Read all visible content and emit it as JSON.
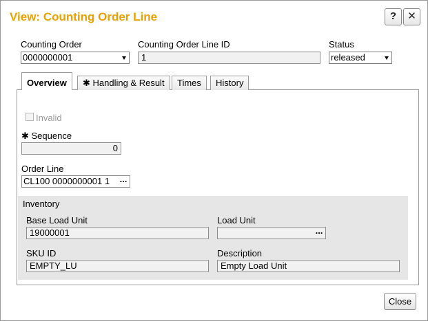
{
  "window": {
    "title": "View: Counting Order Line",
    "help_label": "?",
    "close_label": "✕"
  },
  "header": {
    "counting_order": {
      "label": "Counting Order",
      "value": "0000000001"
    },
    "line_id": {
      "label": "Counting Order Line ID",
      "value": "1"
    },
    "status": {
      "label": "Status",
      "value": "released"
    }
  },
  "tabs": [
    {
      "label": "Overview"
    },
    {
      "label": "✱ Handling & Result"
    },
    {
      "label": "Times"
    },
    {
      "label": "History"
    }
  ],
  "overview": {
    "invalid_label": "Invalid",
    "sequence": {
      "label": "✱ Sequence",
      "value": "0"
    },
    "order_line": {
      "label": "Order Line",
      "value": "CL100 0000000001 1",
      "button": "..."
    }
  },
  "inventory": {
    "heading": "Inventory",
    "base_load_unit": {
      "label": "Base Load Unit",
      "value": "19000001"
    },
    "load_unit": {
      "label": "Load Unit",
      "value": "",
      "button": "..."
    },
    "sku_id": {
      "label": "SKU ID",
      "value": "EMPTY_LU"
    },
    "description": {
      "label": "Description",
      "value": "Empty Load Unit"
    }
  },
  "footer": {
    "close_label": "Close"
  },
  "colors": {
    "title": "#e8a100",
    "field_bg": "#f1f1f1",
    "group_bg": "#e6e6e6"
  }
}
